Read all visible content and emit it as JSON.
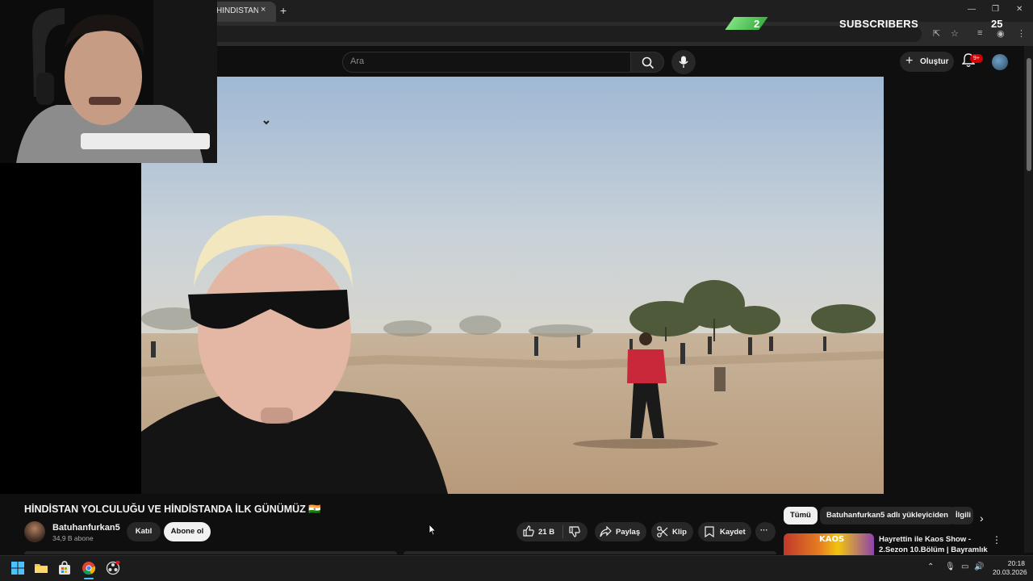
{
  "browser": {
    "tab_title": "HİNDİSTAN YOLCULUĞU VE",
    "tab_close": "×",
    "new_tab": "+",
    "window_controls": [
      "—",
      "❐",
      "✕"
    ]
  },
  "overlay": {
    "left_count": "2",
    "label": "SUBSCRIBERS",
    "right_count": "25"
  },
  "header": {
    "search_placeholder": "Ara",
    "create_label": "Oluştur",
    "notification_badge": "9+"
  },
  "video": {
    "title": "HİNDİSTAN YOLCULUĞU VE HİNDİSTANDA İLK GÜNÜMÜZ 🇮🇳"
  },
  "channel": {
    "name": "Batuhanfurkan5",
    "subscribers": "34,9 B abone",
    "join_label": "Katıl",
    "subscribe_label": "Abone ol"
  },
  "actions": {
    "likes": "21 B",
    "share": "Paylaş",
    "clip": "Klip",
    "save": "Kaydet",
    "more": "···"
  },
  "rail": {
    "chips": [
      "Tümü",
      "Batuhanfurkan5 adlı yükleyiciden",
      "İlgili"
    ],
    "recommendation": {
      "title": "Hayrettin ile Kaos Show - 2.Sezon 10.Bölüm | Bayramlık ...",
      "thumb_text": "KAOS"
    }
  },
  "taskbar": {
    "time": "20:18",
    "date": "20.03.2026"
  },
  "colors": {
    "background": "#0f0f0f",
    "accent_red": "#cc0000",
    "overlay_green": "#3cb043",
    "surface": "#272727"
  }
}
